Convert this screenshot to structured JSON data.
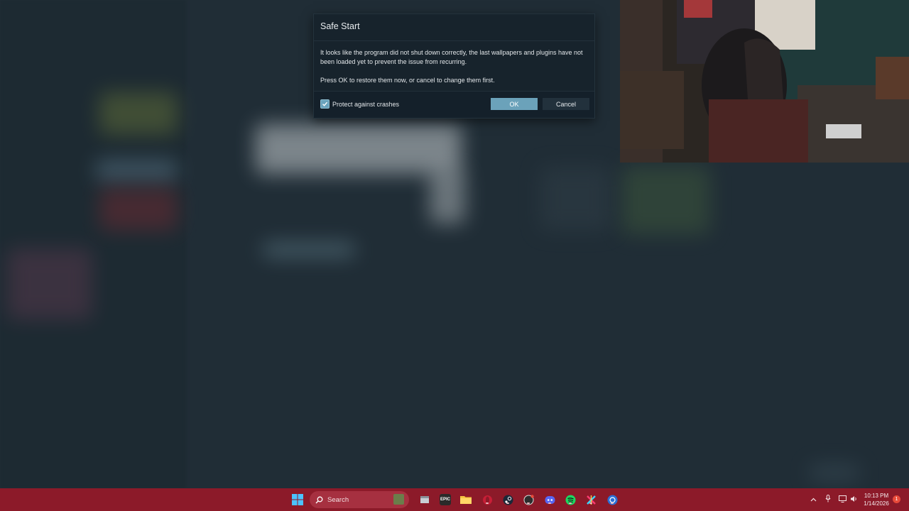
{
  "dialog": {
    "title": "Safe Start",
    "message_1": "It looks like the program did not shut down correctly, the last wallpapers and plugins have not been loaded yet to prevent the issue from recurring.",
    "message_2": "Press OK to restore them now, or cancel to change them first.",
    "checkbox_label": "Protect against crashes",
    "checkbox_checked": true,
    "ok_label": "OK",
    "cancel_label": "Cancel"
  },
  "taskbar": {
    "search_label": "Search",
    "apps": [
      "start-icon",
      "minecraft-icon",
      "file-icon",
      "epic-games-icon",
      "file-explorer-icon",
      "opera-gx-icon",
      "steam-icon",
      "chatgpt-icon",
      "discord-icon",
      "spotify-icon",
      "capcut-icon",
      "wallpaper-engine-icon"
    ],
    "clock_time": "10:13 PM",
    "clock_date": "1/14/2026",
    "notification_count": "1"
  },
  "colors": {
    "taskbar": "#8c1a29",
    "accent": "#6ba2ba",
    "dialog_bg": "#17232c"
  }
}
